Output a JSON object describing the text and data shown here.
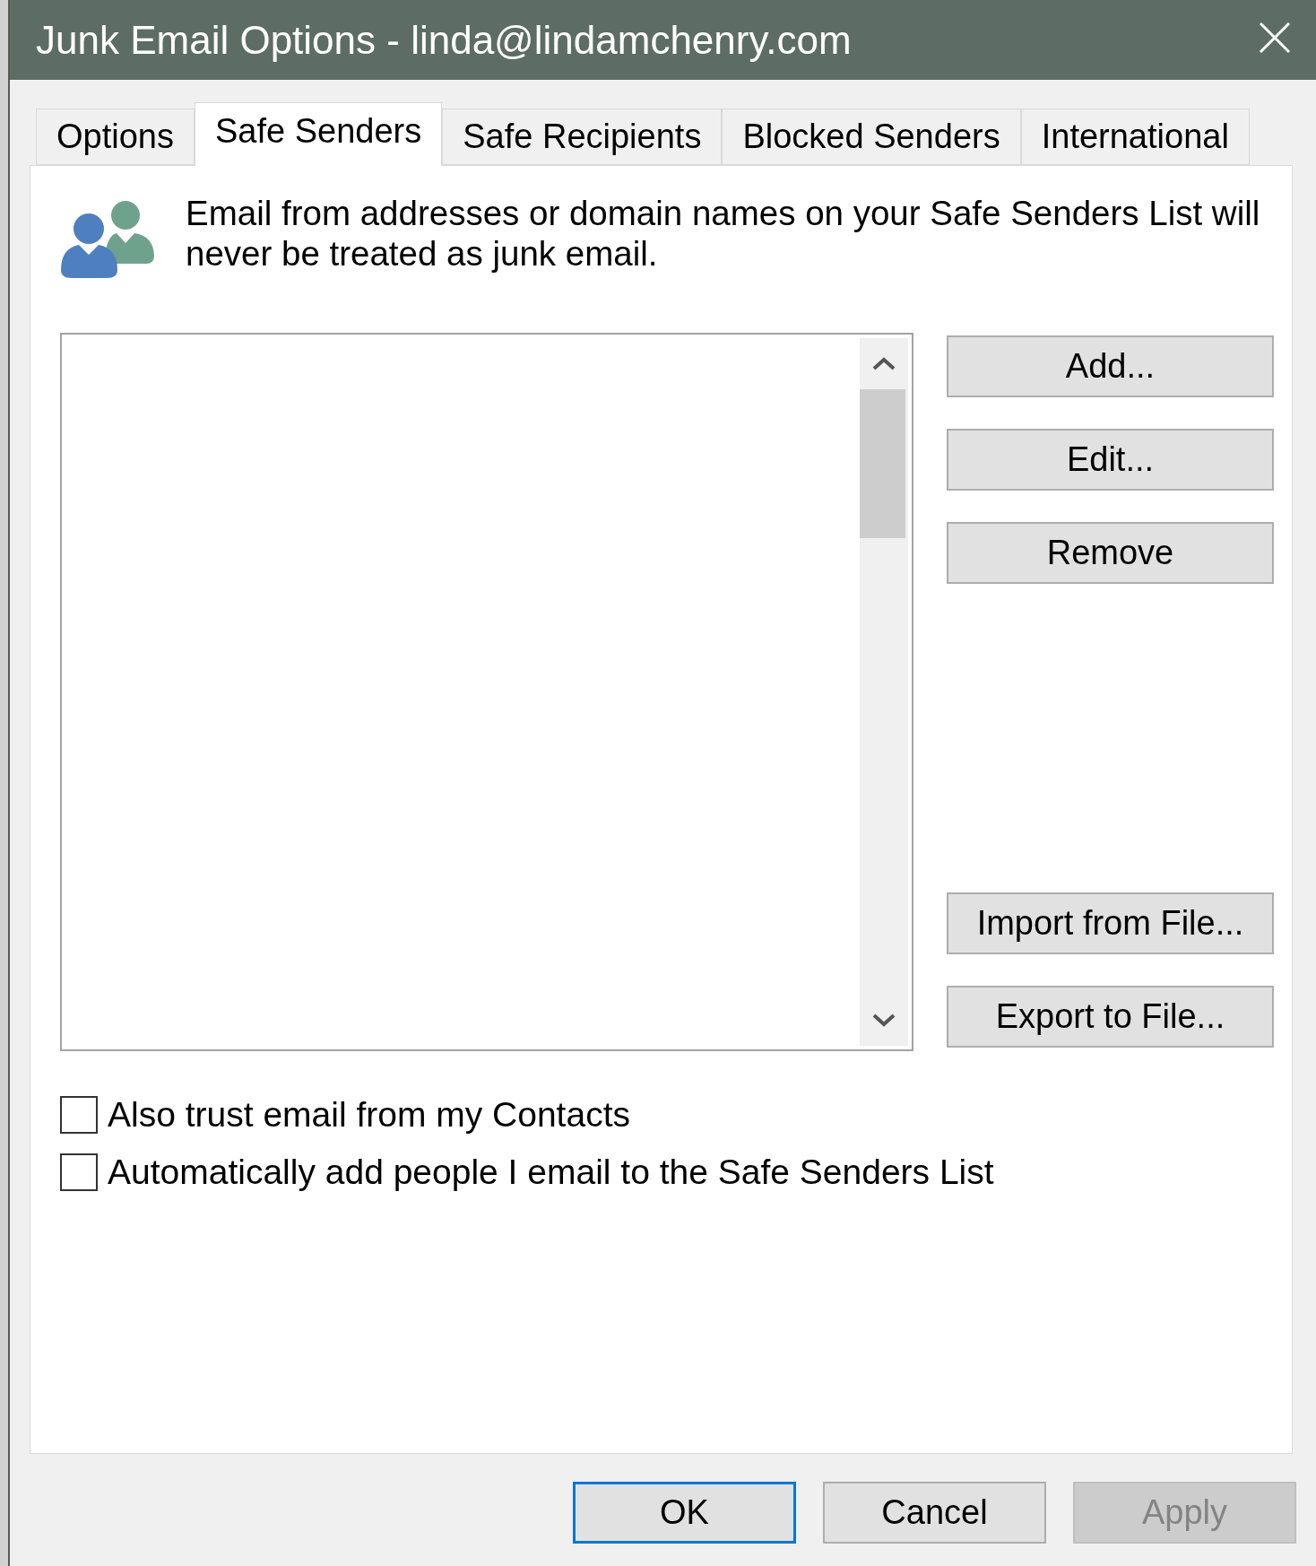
{
  "window": {
    "title": "Junk Email Options - linda@lindamchenry.com"
  },
  "tabs": [
    {
      "label": "Options",
      "selected": false
    },
    {
      "label": "Safe Senders",
      "selected": true
    },
    {
      "label": "Safe Recipients",
      "selected": false
    },
    {
      "label": "Blocked Senders",
      "selected": false
    },
    {
      "label": "International",
      "selected": false
    }
  ],
  "panel": {
    "description": "Email from addresses or domain names on your Safe Senders List will never be treated as junk email.",
    "list_buttons": [
      {
        "label": "Add..."
      },
      {
        "label": "Edit..."
      },
      {
        "label": "Remove"
      }
    ],
    "file_buttons": [
      {
        "label": "Import from File..."
      },
      {
        "label": "Export to File..."
      }
    ],
    "checkboxes": [
      {
        "label": "Also trust email from my Contacts",
        "checked": false
      },
      {
        "label": "Automatically add people I email to the Safe Senders List",
        "checked": false
      }
    ]
  },
  "dialog_buttons": [
    {
      "label": "OK",
      "default": true,
      "disabled": false
    },
    {
      "label": "Cancel",
      "default": false,
      "disabled": false
    },
    {
      "label": "Apply",
      "default": false,
      "disabled": true
    }
  ]
}
